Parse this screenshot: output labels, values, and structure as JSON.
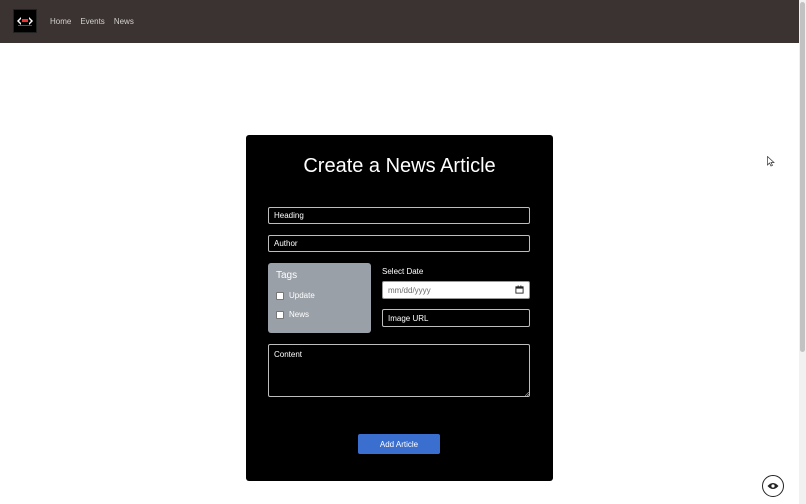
{
  "navbar": {
    "logo_icon": "site-logo-icon",
    "links": [
      "Home",
      "Events",
      "News"
    ],
    "background": "#3b3331"
  },
  "form": {
    "title": "Create a News Article",
    "heading_placeholder": "Heading",
    "author_placeholder": "Author",
    "tags": {
      "title": "Tags",
      "options": [
        "Update",
        "News"
      ]
    },
    "date_label": "Select Date",
    "date_placeholder": "mm/dd/yyyy",
    "image_url_placeholder": "Image URL",
    "content_placeholder": "Content",
    "submit_label": "Add Article",
    "accent_color": "#3a6fd0"
  },
  "icons": {
    "calendar": "calendar-icon",
    "floating": "eye-icon",
    "cursor": "mouse-cursor-icon"
  }
}
